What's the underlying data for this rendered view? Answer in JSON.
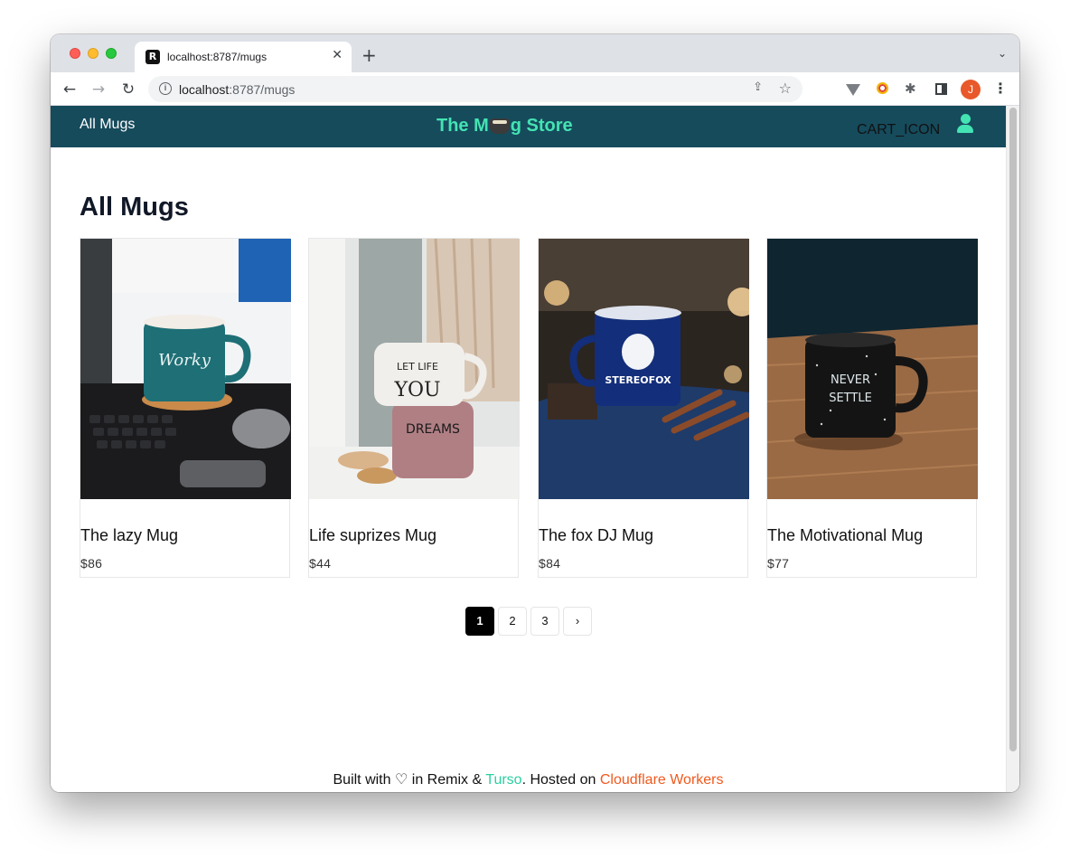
{
  "browser": {
    "tab_title": "localhost:8787/mugs",
    "tab_close": "✕",
    "new_tab": "+",
    "tab_list": "⌄",
    "favicon": "R",
    "url_host": "localhost",
    "url_path": ":8787/mugs",
    "profile_initial": "J",
    "back": "←",
    "forward": "→",
    "reload": "↻",
    "info": "i",
    "share": "⇪",
    "star": "☆",
    "puzzle": "✱",
    "menu": "⋮"
  },
  "header": {
    "nav_all": "All Mugs",
    "title_before": "The M",
    "title_after": "g Store",
    "cart": "CART_ICON",
    "user_icon": "user-icon"
  },
  "page": {
    "heading": "All Mugs"
  },
  "products": [
    {
      "name": "The lazy Mug",
      "price": "$86",
      "image": "teal mug 'Worky today' on cork coaster beside keyboard"
    },
    {
      "name": "Life suprizes Mug",
      "price": "$44",
      "image": "stacked mugs 'Let life surprise you' and 'Dreams' with shells"
    },
    {
      "name": "The fox DJ Mug",
      "price": "$84",
      "image": "navy enamel Stereofox mug with cinnamon and coffee beans"
    },
    {
      "name": "The Motivational Mug",
      "price": "$77",
      "image": "black speckled mug 'Never settle' on wooden table"
    }
  ],
  "pagination": {
    "pages": [
      "1",
      "2",
      "3"
    ],
    "active": "1",
    "next": "›"
  },
  "footer": {
    "prefix": "Built with ♡ in Remix & ",
    "turso": "Turso",
    "middle": ". Hosted on ",
    "cloudflare": "Cloudflare Workers"
  },
  "colors": {
    "header_bg": "#164b5c",
    "brand_accent": "#44e3b3",
    "turso_link": "#2bcfa0",
    "cloudflare_link": "#f05a1e"
  }
}
